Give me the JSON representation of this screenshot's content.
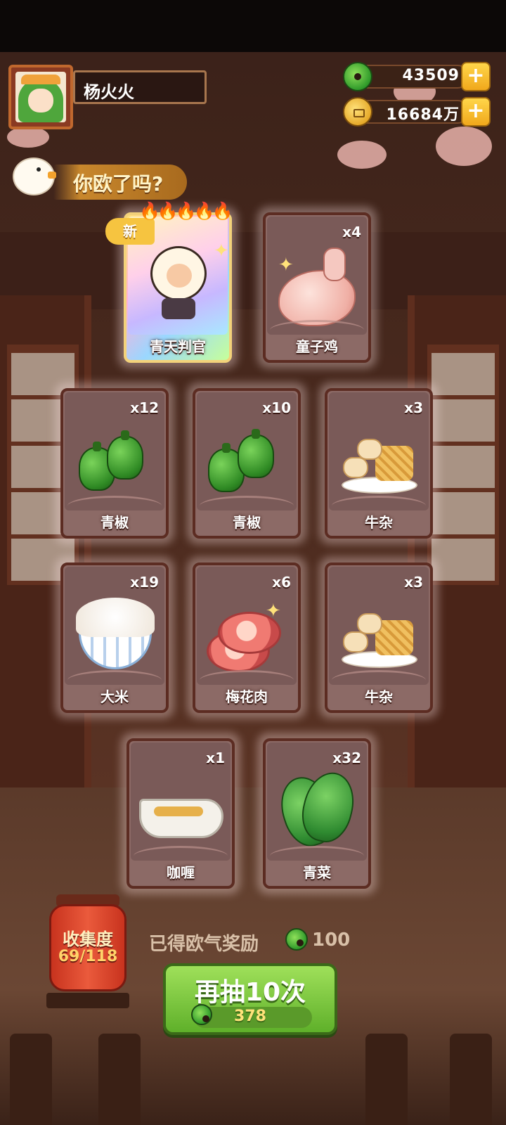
{
  "player": {
    "name": "杨火火"
  },
  "currency": {
    "jade": {
      "value": "43509",
      "icon": "jade-coin-icon",
      "add": "+"
    },
    "coin": {
      "value": "16684万",
      "icon": "gold-coin-icon",
      "add": "+"
    }
  },
  "banner": {
    "text": "你欧了吗?"
  },
  "cards": [
    {
      "name": "青天判官",
      "count": "",
      "new_label": "新",
      "rarity_flames": "🔥🔥🔥🔥🔥",
      "icon": "judge-character-icon"
    },
    {
      "name": "童子鸡",
      "count": "x4",
      "icon": "chicken-icon"
    },
    {
      "name": "青椒",
      "count": "x12",
      "icon": "green-pepper-icon"
    },
    {
      "name": "青椒",
      "count": "x10",
      "icon": "green-pepper-icon"
    },
    {
      "name": "牛杂",
      "count": "x3",
      "icon": "beef-offal-icon"
    },
    {
      "name": "大米",
      "count": "x19",
      "icon": "rice-bowl-icon"
    },
    {
      "name": "梅花肉",
      "count": "x6",
      "icon": "pork-icon"
    },
    {
      "name": "牛杂",
      "count": "x3",
      "icon": "beef-offal-icon"
    },
    {
      "name": "咖喱",
      "count": "x1",
      "icon": "curry-gravy-icon"
    },
    {
      "name": "青菜",
      "count": "x32",
      "icon": "bok-choy-icon"
    }
  ],
  "collection": {
    "label": "收集度",
    "progress": "69/118"
  },
  "reward": {
    "label": "已得欧气奖励",
    "value": "100",
    "icon": "jade-coin-icon"
  },
  "draw_button": {
    "label": "再抽10次",
    "cost": "378",
    "cost_icon": "jade-coin-icon"
  },
  "colors": {
    "draw_button": "#7cc63e",
    "card_frame": "#8c6a66",
    "lantern": "#d9432a",
    "jade": "#2f9a2a",
    "gold": "#f0a81c"
  }
}
